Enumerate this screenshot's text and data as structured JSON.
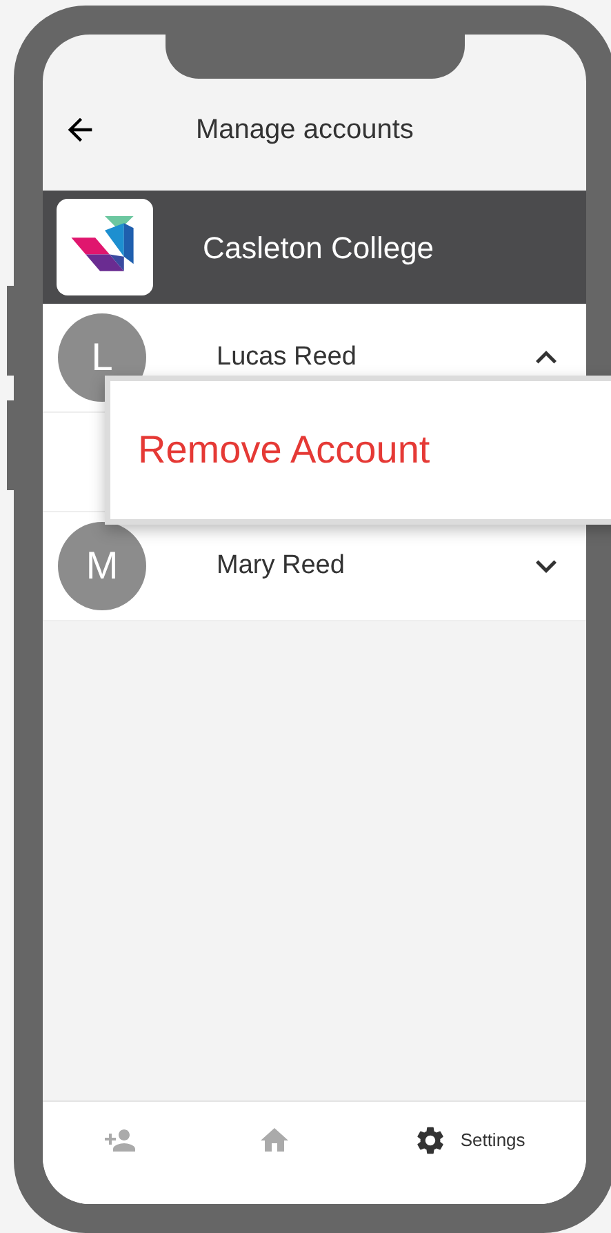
{
  "header": {
    "title": "Manage accounts"
  },
  "school": {
    "name": "Casleton College"
  },
  "accounts": [
    {
      "initial": "L",
      "name": "Lucas Reed",
      "expanded": true
    },
    {
      "initial": "M",
      "name": "Mary Reed",
      "expanded": false
    }
  ],
  "popup_menu": {
    "items": [
      "Remove Account"
    ]
  },
  "bottom_nav": [
    {
      "kind": "add-user",
      "selected": false
    },
    {
      "kind": "home",
      "selected": false
    },
    {
      "kind": "settings",
      "label": "Settings",
      "selected": true
    }
  ]
}
